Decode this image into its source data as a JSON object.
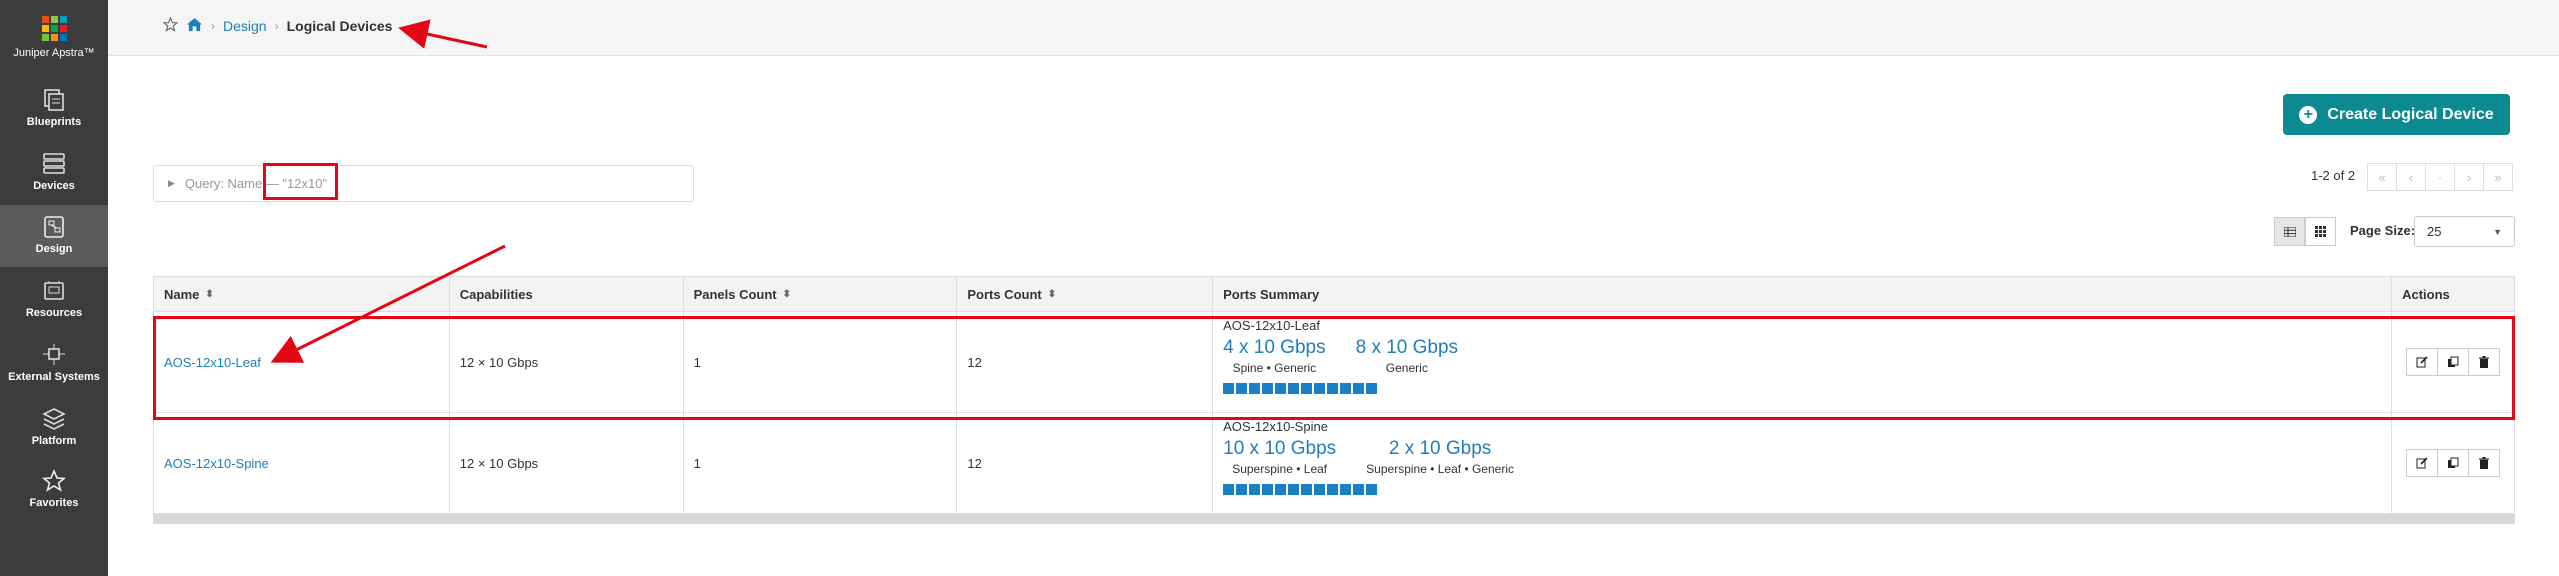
{
  "app": {
    "name": "Juniper Apstra™",
    "logo_colors": [
      "#e94e1b",
      "#8dc63f",
      "#00a0b0",
      "#fcb813",
      "#00a651",
      "#ed1c24",
      "#7ac143",
      "#f7941d",
      "#0072bc"
    ]
  },
  "sidebar": {
    "items": [
      {
        "label": "Blueprints",
        "icon": "blueprints-icon"
      },
      {
        "label": "Devices",
        "icon": "devices-icon"
      },
      {
        "label": "Design",
        "icon": "design-icon",
        "active": true
      },
      {
        "label": "Resources",
        "icon": "resources-icon"
      },
      {
        "label": "External Systems",
        "icon": "external-systems-icon"
      },
      {
        "label": "Platform",
        "icon": "platform-icon"
      },
      {
        "label": "Favorites",
        "icon": "star-icon"
      }
    ]
  },
  "breadcrumb": {
    "items": [
      "Design",
      "Logical Devices"
    ]
  },
  "toolbar": {
    "create_label": "Create Logical Device",
    "query_text": "Query: Name — \"12x10\"",
    "pager_text": "1-2 of 2",
    "pager_buttons": [
      "«",
      "‹",
      "·",
      "›",
      "»"
    ],
    "page_size_label": "Page Size:",
    "page_size_value": "25"
  },
  "table": {
    "headers": [
      "Name",
      "Capabilities",
      "Panels Count",
      "Ports Count",
      "Ports Summary",
      "Actions"
    ],
    "rows": [
      {
        "name": "AOS-12x10-Leaf",
        "capabilities": "12 × 10 Gbps",
        "panels": "1",
        "ports": "12",
        "summary_title": "AOS-12x10-Leaf",
        "groups": [
          {
            "speed": "4 x 10 Gbps",
            "roles": "Spine • Generic"
          },
          {
            "speed": "8 x 10 Gbps",
            "roles": "Generic"
          }
        ],
        "port_count": 12
      },
      {
        "name": "AOS-12x10-Spine",
        "capabilities": "12 × 10 Gbps",
        "panels": "1",
        "ports": "12",
        "summary_title": "AOS-12x10-Spine",
        "groups": [
          {
            "speed": "10 x 10 Gbps",
            "roles": "Superspine • Leaf"
          },
          {
            "speed": "2 x 10 Gbps",
            "roles": "Superspine • Leaf • Generic"
          }
        ],
        "port_count": 12
      }
    ]
  },
  "colors": {
    "accent": "#0b8a92",
    "link": "#1f7fb8",
    "port": "#1a80c4",
    "annotation": "#e30613",
    "sidebar": "#3c3c3c"
  }
}
